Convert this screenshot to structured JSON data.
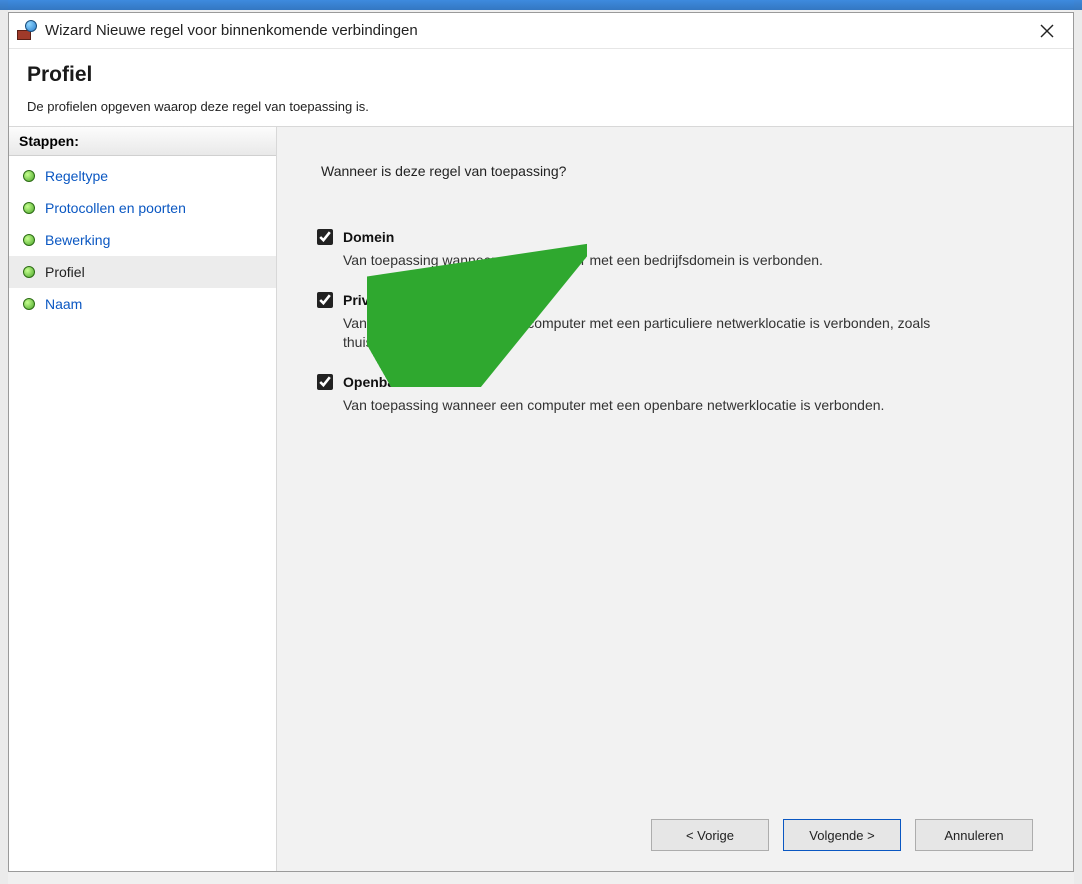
{
  "window": {
    "title": "Wizard Nieuwe regel voor binnenkomende verbindingen"
  },
  "header": {
    "title": "Profiel",
    "subtitle": "De profielen opgeven waarop deze regel van toepassing is."
  },
  "sidebar": {
    "heading": "Stappen:",
    "steps": [
      {
        "label": "Regeltype",
        "state": "link"
      },
      {
        "label": "Protocollen en poorten",
        "state": "link"
      },
      {
        "label": "Bewerking",
        "state": "link"
      },
      {
        "label": "Profiel",
        "state": "current"
      },
      {
        "label": "Naam",
        "state": "link"
      }
    ]
  },
  "content": {
    "question": "Wanneer is deze regel van toepassing?",
    "options": [
      {
        "label": "Domein",
        "checked": true,
        "description": "Van toepassing wanneer een computer met een bedrijfsdomein is verbonden."
      },
      {
        "label": "Privé",
        "checked": true,
        "description": "Van toepassing wanneer een computer met een particuliere netwerklocatie is verbonden, zoals thuis of op het werk."
      },
      {
        "label": "Openbaar",
        "checked": true,
        "description": "Van toepassing wanneer een computer met een openbare netwerklocatie is verbonden."
      }
    ]
  },
  "buttons": {
    "back": "< Vorige",
    "next": "Volgende >",
    "cancel": "Annuleren"
  }
}
